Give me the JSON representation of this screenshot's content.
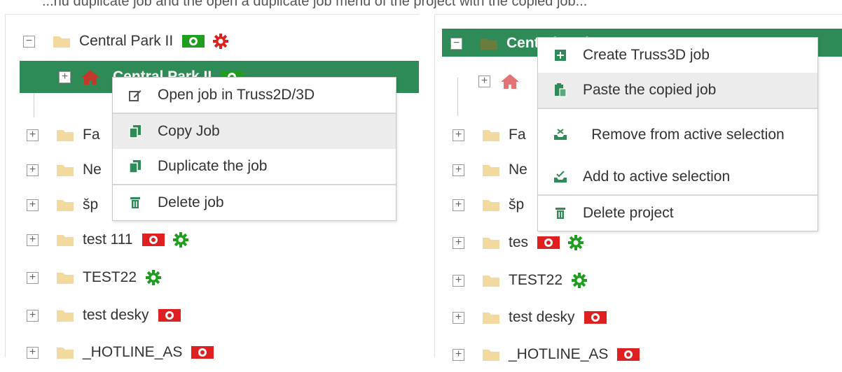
{
  "top_caption": "...nu duplicate job and the open a duplicate job menu of the project with the copied job...",
  "left_panel": {
    "rows": [
      {
        "label": "Central Park II",
        "toggle": "−",
        "badges": [
          "money-green",
          "gear-red"
        ]
      },
      {
        "label": "Central Park II",
        "toggle": "+",
        "icon": "house-icon",
        "badges": [
          "money-green"
        ],
        "selected": true
      },
      {
        "label": "Fa",
        "toggle": "+"
      },
      {
        "label": "Ne",
        "toggle": "+"
      },
      {
        "label": "šp",
        "toggle": "+"
      },
      {
        "label": "test 111",
        "toggle": "+",
        "badges": [
          "money-red",
          "gear-green"
        ]
      },
      {
        "label": "TEST22",
        "toggle": "+",
        "badges": [
          "gear-green"
        ]
      },
      {
        "label": "test desky",
        "toggle": "+",
        "badges": [
          "money-red"
        ]
      },
      {
        "label": "_HOTLINE_AS",
        "toggle": "+",
        "badges": [
          "money-red"
        ]
      }
    ],
    "context_menu": {
      "items": [
        {
          "label": "Open job in Truss2D/3D",
          "icon": "edit-icon"
        },
        {
          "label": "Copy Job",
          "icon": "copy-icon",
          "highlighted": true
        },
        {
          "label": "Duplicate the job",
          "icon": "copy-icon"
        },
        {
          "label": "Delete job",
          "icon": "trash-icon"
        }
      ]
    }
  },
  "right_panel": {
    "rows": [
      {
        "label": "Central Park II",
        "toggle": "−",
        "selected": true
      },
      {
        "label": "",
        "toggle": "+",
        "icon": "house-icon"
      },
      {
        "label": "Fa",
        "toggle": "+"
      },
      {
        "label": "Ne",
        "toggle": "+"
      },
      {
        "label": "šp",
        "toggle": "+"
      },
      {
        "label": "tes",
        "toggle": "+",
        "badges": [
          "money-red",
          "gear-green"
        ]
      },
      {
        "label": "TEST22",
        "toggle": "+",
        "badges": [
          "gear-green"
        ]
      },
      {
        "label": "test desky",
        "toggle": "+",
        "badges": [
          "money-red"
        ]
      },
      {
        "label": "_HOTLINE_AS",
        "toggle": "+",
        "badges": [
          "money-red"
        ]
      }
    ],
    "context_menu": {
      "items": [
        {
          "label": "Create Truss3D job",
          "icon": "plus-icon"
        },
        {
          "label": "Paste the copied job",
          "icon": "paste-icon",
          "highlighted": true
        },
        {
          "label": "Remove from active selection",
          "icon": "tray-remove-icon"
        },
        {
          "label": "Add to active selection",
          "icon": "tray-add-icon"
        },
        {
          "label": "Delete project",
          "icon": "trash-icon"
        }
      ]
    }
  },
  "colors": {
    "selection": "#2e8b57",
    "green": "#1f9d1f",
    "red": "#e02020",
    "folder": "#f2d9a0",
    "house": "#c0392b"
  }
}
